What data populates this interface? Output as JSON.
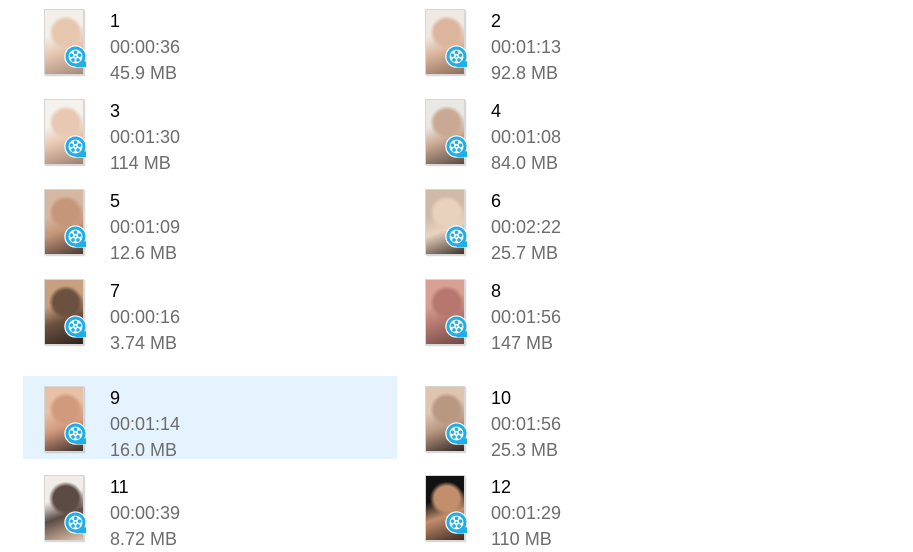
{
  "accent_color": "#e5f3ff",
  "badge_icon": "video-player-icon",
  "files": [
    {
      "name": "1",
      "duration": "00:00:36",
      "size": "45.9 MB",
      "selected": false,
      "thumb": [
        "#f3efe9",
        "#e7c6ae",
        "#a58a7a"
      ]
    },
    {
      "name": "2",
      "duration": "00:01:13",
      "size": "92.8 MB",
      "selected": false,
      "thumb": [
        "#efe9e2",
        "#dcb59c",
        "#8d6d5a"
      ]
    },
    {
      "name": "3",
      "duration": "00:01:30",
      "size": "114 MB",
      "selected": false,
      "thumb": [
        "#f5f1ec",
        "#e8c8b2",
        "#9c7f6d"
      ]
    },
    {
      "name": "4",
      "duration": "00:01:08",
      "size": "84.0 MB",
      "selected": false,
      "thumb": [
        "#eae8e4",
        "#c9a993",
        "#5a4b43"
      ]
    },
    {
      "name": "5",
      "duration": "00:01:09",
      "size": "12.6 MB",
      "selected": false,
      "thumb": [
        "#d6b7a2",
        "#c5967a",
        "#4a3a33"
      ]
    },
    {
      "name": "6",
      "duration": "00:02:22",
      "size": "25.7 MB",
      "selected": false,
      "thumb": [
        "#cfb9a7",
        "#e9d2bd",
        "#3b322d"
      ]
    },
    {
      "name": "7",
      "duration": "00:00:16",
      "size": "3.74 MB",
      "selected": false,
      "thumb": [
        "#c8a07f",
        "#6d5140",
        "#2e2520"
      ]
    },
    {
      "name": "8",
      "duration": "00:01:56",
      "size": "147 MB",
      "selected": false,
      "thumb": [
        "#d89f93",
        "#b6786e",
        "#6f4a45"
      ]
    },
    {
      "name": "9",
      "duration": "00:01:14",
      "size": "16.0 MB",
      "selected": true,
      "thumb": [
        "#e7c0a5",
        "#d29a7c",
        "#3a2f2a"
      ]
    },
    {
      "name": "10",
      "duration": "00:01:56",
      "size": "25.3 MB",
      "selected": false,
      "thumb": [
        "#dfc4af",
        "#b99882",
        "#2d2622"
      ]
    },
    {
      "name": "11",
      "duration": "00:00:39",
      "size": "8.72 MB",
      "selected": false,
      "thumb": [
        "#f1ece7",
        "#5b4b44",
        "#e6c5ae"
      ]
    },
    {
      "name": "12",
      "duration": "00:01:29",
      "size": "110 MB",
      "selected": false,
      "thumb": [
        "#111111",
        "#c28e6b",
        "#3c2a21"
      ]
    }
  ]
}
